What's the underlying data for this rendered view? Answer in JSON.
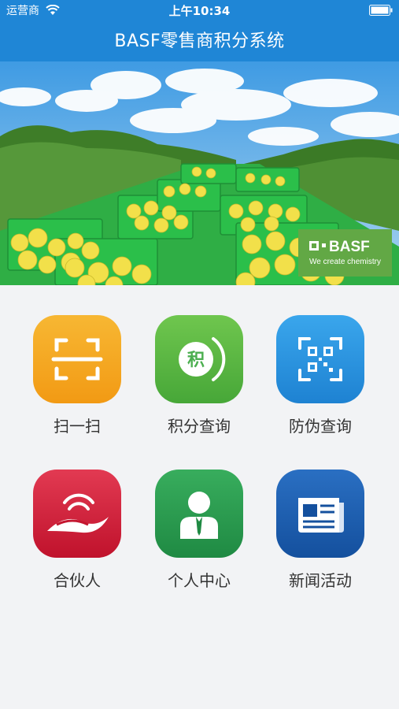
{
  "status_bar": {
    "carrier": "运营商",
    "time": "上午10:34"
  },
  "header": {
    "title": "BASF零售商积分系统"
  },
  "banner": {
    "brand_name": "BASF",
    "brand_tagline": "We create chemistry"
  },
  "menu": [
    {
      "label": "扫一扫",
      "icon": "scan-icon",
      "color": "#f5a623"
    },
    {
      "label": "积分查询",
      "icon": "points-icon",
      "color": "#5cb84a",
      "icon_text": "积"
    },
    {
      "label": "防伪查询",
      "icon": "qr-code-icon",
      "color": "#2f9be4"
    },
    {
      "label": "合伙人",
      "icon": "partner-icon",
      "color": "#d4203c"
    },
    {
      "label": "个人中心",
      "icon": "user-icon",
      "color": "#2e9b50"
    },
    {
      "label": "新闻活动",
      "icon": "news-icon",
      "color": "#1b5fb0"
    }
  ]
}
